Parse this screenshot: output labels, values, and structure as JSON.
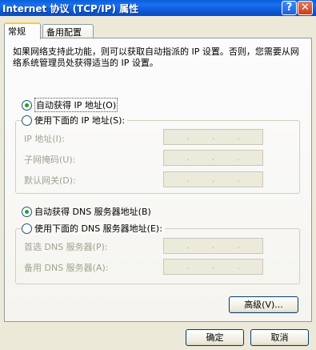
{
  "window": {
    "title": "Internet 协议 (TCP/IP) 属性",
    "help_glyph": "?",
    "close_glyph": "✕"
  },
  "tabs": [
    {
      "label": "常规",
      "active": true
    },
    {
      "label": "备用配置",
      "active": false
    }
  ],
  "description": "如果网络支持此功能，则可以获取自动指派的 IP 设置。否则，您需要从网络系统管理员处获得适当的 IP 设置。",
  "ip_section": {
    "auto_label": "自动获得 IP 地址(O)",
    "auto_selected": true,
    "manual_label": "使用下面的 IP 地址(S):",
    "fields": [
      {
        "label": "IP 地址(I):"
      },
      {
        "label": "子网掩码(U):"
      },
      {
        "label": "默认网关(D):"
      }
    ]
  },
  "dns_section": {
    "auto_label": "自动获得 DNS 服务器地址(B)",
    "auto_selected": true,
    "manual_label": "使用下面的 DNS 服务器地址(E):",
    "fields": [
      {
        "label": "首选 DNS 服务器(P):"
      },
      {
        "label": "备用 DNS 服务器(A):"
      }
    ]
  },
  "buttons": {
    "advanced": "高级(V)...",
    "ok": "确定",
    "cancel": "取消"
  }
}
